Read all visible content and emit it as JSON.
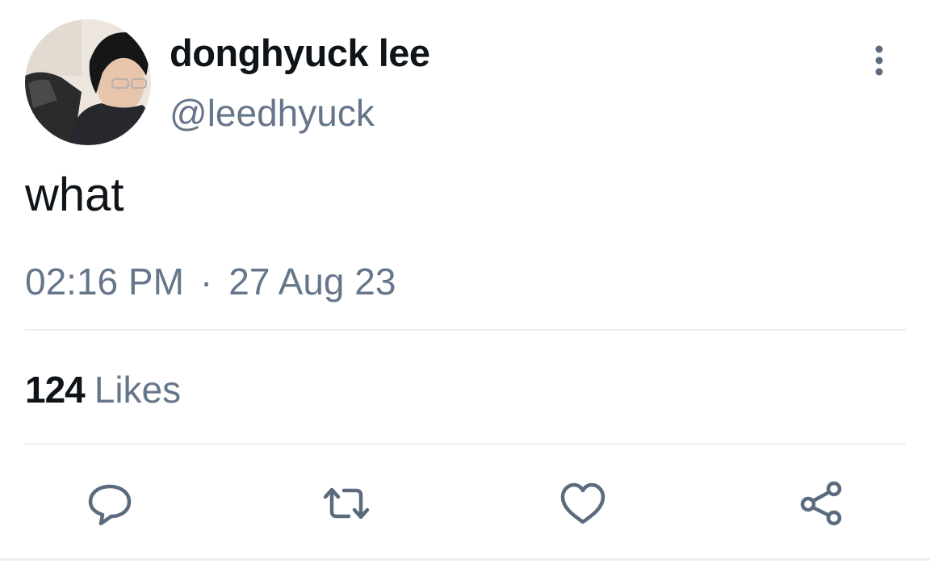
{
  "user": {
    "display_name": "donghyuck lee",
    "handle": "@leedhyuck"
  },
  "tweet": {
    "text": "what",
    "time": "02:16 PM",
    "separator": "·",
    "date": "27 Aug 23"
  },
  "stats": {
    "likes_count": "124",
    "likes_label": "Likes"
  },
  "icons": {
    "more": "more-vertical-icon",
    "reply": "reply-icon",
    "retweet": "retweet-icon",
    "like": "heart-icon",
    "share": "share-icon"
  },
  "colors": {
    "text_primary": "#0f1419",
    "text_secondary": "#66768a",
    "divider": "#eceef0"
  }
}
